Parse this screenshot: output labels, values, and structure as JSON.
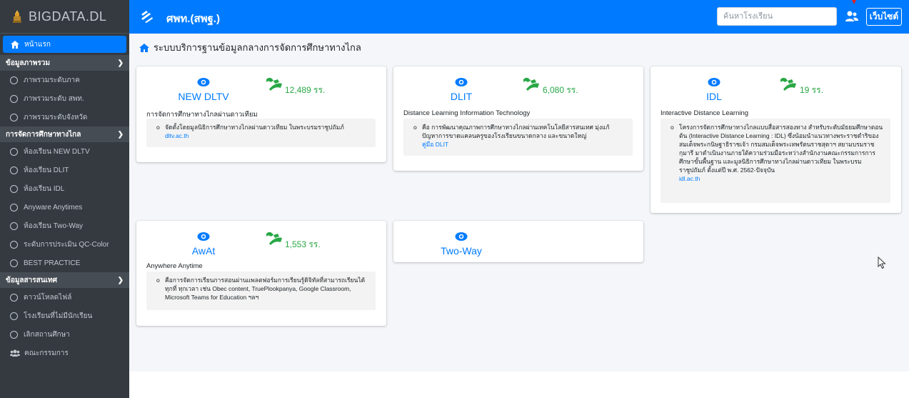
{
  "brand": {
    "text": "BIGDATA.DL"
  },
  "header": {
    "org_title": "ศพท.(สพฐ.)",
    "search_placeholder": "ค้นหาโรงเรียน",
    "website_label": "เว็บไซต์"
  },
  "colors": {
    "primary": "#007bff",
    "sidebar": "#343a40",
    "success": "#28a745",
    "background": "#f4f6f9"
  },
  "sidebar": {
    "home": "หน้าแรก",
    "sections": [
      {
        "title": "ข้อมูลภาพรวม",
        "items": [
          "ภาพรวมระดับภาค",
          "ภาพรวมระดับ สพท.",
          "ภาพรวมระดับจังหวัด"
        ]
      },
      {
        "title": "การจัดการศึกษาทางไกล",
        "items": [
          "ห้องเรียน NEW DLTV",
          "ห้องเรียน DLIT",
          "ห้องเรียน IDL",
          "Anyware Anytimes",
          "ห้องเรียน Two-Way",
          "ระดับการประเมิน QC-Color",
          "BEST PRACTICE"
        ]
      },
      {
        "title": "ข้อมูลสารสนเทศ",
        "items": [
          "ดาวน์โหลดไฟล์",
          "โรงเรียนที่ไม่มีนักเรียน",
          "เลิกสถานศึกษา"
        ]
      }
    ],
    "committee": "คณะกรรมการ"
  },
  "main": {
    "title": "ระบบบริการฐานข้อมูลกลางการจัดการศึกษาทางไกล",
    "cards": [
      {
        "name": "NEW DLTV",
        "count": "12,489 รร.",
        "subtitle": "การจัดการศึกษาทางไกลผ่านดาวเทียม",
        "desc": "จัดตั้งโดยมูลนิธิการศึกษาทางไกลผ่านดาวเทียม ในพระบรมราชูปถัมภ์",
        "link": "dltv.ac.th"
      },
      {
        "name": "DLIT",
        "count": "6,080 รร.",
        "subtitle": "Distance Learning Information Technology",
        "desc": "คือ การพัฒนาคุณภาพการศึกษาทางไกลผ่านเทคโนโลยีสารสนเทศ มุ่งแก้ปัญหาการขาดแคลนครูของโรงเรียนขนาดกลาง และขนาดใหญ่",
        "link": "คู่มือ DLIT"
      },
      {
        "name": "IDL",
        "count": "19 รร.",
        "subtitle": "Interactive Distance Learning",
        "desc": "โครงการจัดการศึกษาทางไกลแบบสื่อสารสองทาง สำหรับระดับมัธยมศึกษาตอนต้น (Interactive Distance Learning : IDL) ซึ่งน้อมนำแนวทางพระราชดำริของสมเด็จพระกนิษฐาธิราชเจ้า กรมสมเด็จพระเทพรัตนราชสุดาฯ สยามบรมราชกุมารี มาดำเนินงานภายใต้ความร่วมมือระหว่างสำนักงานคณะกรรมการการศึกษาขั้นพื้นฐาน และมูลนิธิการศึกษาทางไกลผ่านดาวเทียม ในพระบรมราชูปถัมภ์ ตั้งแต่ปี พ.ศ. 2562-ปัจจุบัน",
        "link": "idl.ac.th"
      },
      {
        "name": "AwAt",
        "count": "1,553 รร.",
        "subtitle": "Anywhere Anytime",
        "desc": "คือการจัดการเรียนการสอนผ่านแพลตฟอร์มการเรียนรู้ดิจิทัลที่สามารถเรียนได้ทุกที่ ทุกเวลา เช่น Obec content, TruePlookpanya, Google Classroom, Microsoft Teams for Education ฯลฯ",
        "link": ""
      },
      {
        "name": "Two-Way"
      }
    ]
  }
}
